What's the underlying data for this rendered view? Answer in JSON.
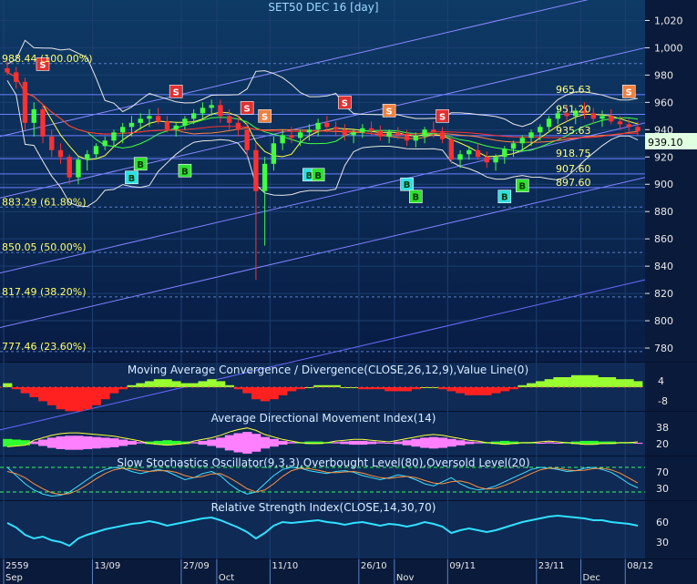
{
  "chart_data": {
    "type": "candlestick",
    "title": "SET50 DEC 16   [day]",
    "last_price": "939.10",
    "ylim": [
      770,
      1035
    ],
    "y_ticks": [
      "780",
      "800",
      "820",
      "840",
      "860",
      "880",
      "900",
      "920",
      "940",
      "960",
      "980",
      "1,000",
      "1,020"
    ],
    "y_tick_values": [
      780,
      800,
      820,
      840,
      860,
      880,
      900,
      920,
      940,
      960,
      980,
      1000,
      1020
    ],
    "x_labels": [
      "2559",
      "Sep",
      "13/09",
      "27/09",
      "Oct",
      "11/10",
      "26/10",
      "Nov",
      "09/11",
      "23/11",
      "Dec",
      "08/12"
    ],
    "x_label_index": [
      0,
      0,
      10,
      20,
      24,
      30,
      40,
      44,
      50,
      60,
      65,
      70
    ],
    "x_label_row": [
      0,
      1,
      0,
      0,
      1,
      0,
      0,
      1,
      0,
      0,
      1,
      0
    ],
    "fibonacci": [
      {
        "label": "988.44 (100.00%)",
        "value": 988.44
      },
      {
        "label": "883.29 (61.80%)",
        "value": 883.29
      },
      {
        "label": "850.05 (50.00%)",
        "value": 850.05
      },
      {
        "label": "817.49 (38.20%)",
        "value": 817.49
      },
      {
        "label": "777.46 (23.60%)",
        "value": 777.46
      }
    ],
    "levels": [
      {
        "label": "965.63",
        "value": 965.63
      },
      {
        "label": "951.20",
        "value": 951.2
      },
      {
        "label": "935.63",
        "value": 935.63
      },
      {
        "label": "918.75",
        "value": 918.75
      },
      {
        "label": "907.60",
        "value": 907.6
      },
      {
        "label": "897.60",
        "value": 897.6
      }
    ],
    "candles": [
      [
        985,
        990,
        980,
        982
      ],
      [
        982,
        986,
        970,
        975
      ],
      [
        975,
        978,
        940,
        945
      ],
      [
        945,
        960,
        935,
        955
      ],
      [
        955,
        958,
        930,
        935
      ],
      [
        935,
        940,
        920,
        925
      ],
      [
        925,
        930,
        915,
        920
      ],
      [
        920,
        922,
        900,
        905
      ],
      [
        905,
        920,
        900,
        918
      ],
      [
        918,
        925,
        910,
        922
      ],
      [
        922,
        930,
        918,
        928
      ],
      [
        928,
        935,
        925,
        932
      ],
      [
        932,
        940,
        928,
        938
      ],
      [
        938,
        945,
        930,
        942
      ],
      [
        942,
        950,
        935,
        945
      ],
      [
        945,
        952,
        940,
        948
      ],
      [
        948,
        955,
        942,
        950
      ],
      [
        950,
        956,
        944,
        946
      ],
      [
        946,
        950,
        938,
        940
      ],
      [
        940,
        945,
        935,
        943
      ],
      [
        943,
        950,
        940,
        948
      ],
      [
        948,
        955,
        944,
        952
      ],
      [
        952,
        960,
        948,
        956
      ],
      [
        956,
        962,
        950,
        958
      ],
      [
        958,
        962,
        945,
        950
      ],
      [
        950,
        955,
        940,
        945
      ],
      [
        945,
        950,
        935,
        940
      ],
      [
        940,
        945,
        920,
        925
      ],
      [
        925,
        930,
        830,
        895
      ],
      [
        895,
        920,
        855,
        915
      ],
      [
        915,
        935,
        910,
        930
      ],
      [
        930,
        940,
        925,
        936
      ],
      [
        936,
        942,
        930,
        934
      ],
      [
        934,
        940,
        928,
        938
      ],
      [
        938,
        944,
        932,
        940
      ],
      [
        940,
        948,
        935,
        945
      ],
      [
        945,
        950,
        938,
        942
      ],
      [
        942,
        946,
        935,
        940
      ],
      [
        940,
        944,
        932,
        936
      ],
      [
        936,
        940,
        930,
        938
      ],
      [
        938,
        944,
        934,
        941
      ],
      [
        941,
        946,
        936,
        939
      ],
      [
        939,
        943,
        932,
        935
      ],
      [
        935,
        940,
        930,
        938
      ],
      [
        938,
        942,
        933,
        936
      ],
      [
        936,
        940,
        928,
        932
      ],
      [
        932,
        938,
        927,
        935
      ],
      [
        935,
        942,
        930,
        940
      ],
      [
        940,
        946,
        934,
        938
      ],
      [
        938,
        942,
        930,
        933
      ],
      [
        933,
        936,
        915,
        918
      ],
      [
        918,
        925,
        912,
        922
      ],
      [
        922,
        928,
        918,
        925
      ],
      [
        925,
        930,
        918,
        920
      ],
      [
        920,
        924,
        912,
        916
      ],
      [
        916,
        922,
        910,
        920
      ],
      [
        920,
        928,
        915,
        926
      ],
      [
        926,
        932,
        920,
        930
      ],
      [
        930,
        936,
        925,
        934
      ],
      [
        934,
        940,
        928,
        938
      ],
      [
        938,
        944,
        932,
        942
      ],
      [
        942,
        950,
        938,
        948
      ],
      [
        948,
        956,
        944,
        952
      ],
      [
        952,
        958,
        946,
        950
      ],
      [
        950,
        956,
        944,
        954
      ],
      [
        954,
        960,
        948,
        952
      ],
      [
        952,
        956,
        944,
        948
      ],
      [
        948,
        954,
        942,
        950
      ],
      [
        950,
        955,
        944,
        946
      ],
      [
        946,
        950,
        940,
        944
      ],
      [
        944,
        948,
        938,
        942
      ],
      [
        942,
        946,
        936,
        939
      ]
    ],
    "signals": [
      {
        "i": 4,
        "price": 988,
        "text": "S",
        "color": "#e03030",
        "above": true
      },
      {
        "i": 19,
        "price": 968,
        "text": "S",
        "color": "#e03030",
        "above": true
      },
      {
        "i": 27,
        "price": 956,
        "text": "S",
        "color": "#e03030",
        "above": true
      },
      {
        "i": 29,
        "price": 950,
        "text": "S",
        "color": "#f08040",
        "above": true
      },
      {
        "i": 38,
        "price": 960,
        "text": "S",
        "color": "#e03030",
        "above": true
      },
      {
        "i": 43,
        "price": 954,
        "text": "S",
        "color": "#f08040",
        "above": true
      },
      {
        "i": 49,
        "price": 950,
        "text": "S",
        "color": "#e03030",
        "above": true
      },
      {
        "i": 70,
        "price": 968,
        "text": "S",
        "color": "#f08040",
        "above": true
      },
      {
        "i": 14,
        "price": 905,
        "text": "B",
        "color": "#30e0e0",
        "above": false
      },
      {
        "i": 15,
        "price": 915,
        "text": "B",
        "color": "#30e030",
        "above": false
      },
      {
        "i": 20,
        "price": 910,
        "text": "B",
        "color": "#30e030",
        "above": false
      },
      {
        "i": 34,
        "price": 907,
        "text": "B",
        "color": "#30e0e0",
        "above": false
      },
      {
        "i": 35,
        "price": 907,
        "text": "B",
        "color": "#30e030",
        "above": false
      },
      {
        "i": 45,
        "price": 900,
        "text": "B",
        "color": "#30e0e0",
        "above": false
      },
      {
        "i": 46,
        "price": 891,
        "text": "B",
        "color": "#30e030",
        "above": false
      },
      {
        "i": 56,
        "price": 891,
        "text": "B",
        "color": "#30e0e0",
        "above": false
      },
      {
        "i": 58,
        "price": 899,
        "text": "B",
        "color": "#30e030",
        "above": false
      }
    ]
  },
  "panels": {
    "macd": {
      "title": "Moving Average Convergence / Divergence(CLOSE,26,12,9),Value Line(0)",
      "y_ticks": [
        "4",
        "-8"
      ],
      "values": [
        2,
        -1,
        -3,
        -5,
        -7,
        -9,
        -11,
        -12,
        -12,
        -11,
        -9,
        -6,
        -3,
        -1,
        1,
        2,
        3,
        4,
        4,
        3,
        2,
        2,
        3,
        4,
        3,
        1,
        -1,
        -3,
        -6,
        -7,
        -6,
        -4,
        -2,
        -1,
        0,
        1,
        1,
        1,
        0,
        0,
        -1,
        -1,
        -1,
        -2,
        -2,
        -2,
        -1,
        0,
        0,
        -1,
        -2,
        -3,
        -4,
        -4,
        -4,
        -3,
        -2,
        -1,
        1,
        2,
        3,
        4,
        5,
        5,
        6,
        6,
        6,
        5,
        5,
        4,
        4,
        3
      ]
    },
    "adx": {
      "title": "Average Directional Movement Index(14)",
      "y_ticks": [
        "38",
        "20"
      ],
      "values": [
        -6,
        -5,
        -4,
        2,
        5,
        8,
        10,
        11,
        11,
        10,
        9,
        8,
        7,
        5,
        3,
        1,
        -2,
        -3,
        -4,
        -3,
        -2,
        1,
        3,
        5,
        8,
        12,
        15,
        17,
        14,
        9,
        6,
        3,
        1,
        -1,
        -2,
        -2,
        -1,
        1,
        2,
        3,
        3,
        2,
        1,
        0,
        2,
        4,
        6,
        8,
        9,
        8,
        6,
        4,
        2,
        1,
        -1,
        -2,
        -3,
        -2,
        -1,
        -1,
        0,
        1,
        0,
        -1,
        -2,
        -3,
        -3,
        -2,
        -2,
        -1,
        -1,
        0
      ]
    },
    "stochastic": {
      "title": "Slow Stochastics Oscillator(9,3,3),Overbought Level(80),Oversold Level(20)",
      "y_ticks": [
        "70",
        "30"
      ],
      "k": [
        80,
        60,
        40,
        25,
        15,
        10,
        12,
        20,
        35,
        50,
        65,
        75,
        80,
        78,
        70,
        65,
        70,
        75,
        70,
        60,
        50,
        55,
        65,
        70,
        60,
        40,
        25,
        15,
        20,
        40,
        60,
        75,
        80,
        78,
        72,
        68,
        65,
        70,
        72,
        68,
        60,
        55,
        50,
        55,
        62,
        58,
        50,
        40,
        35,
        45,
        55,
        40,
        30,
        25,
        28,
        35,
        45,
        55,
        65,
        75,
        80,
        78,
        75,
        70,
        72,
        78,
        80,
        75,
        68,
        55,
        40,
        30
      ],
      "d": [
        70,
        65,
        55,
        40,
        28,
        18,
        14,
        16,
        25,
        38,
        52,
        65,
        74,
        78,
        76,
        72,
        70,
        72,
        72,
        68,
        60,
        55,
        58,
        64,
        65,
        55,
        42,
        28,
        20,
        25,
        40,
        58,
        72,
        78,
        77,
        73,
        68,
        67,
        69,
        70,
        66,
        60,
        55,
        53,
        56,
        58,
        55,
        48,
        42,
        40,
        45,
        47,
        42,
        32,
        27,
        29,
        36,
        45,
        55,
        65,
        74,
        78,
        78,
        74,
        72,
        73,
        77,
        78,
        74,
        66,
        54,
        42
      ]
    },
    "rsi": {
      "title": "Relative Strength Index(CLOSE,14,30,70)",
      "y_ticks": [
        "60",
        "30"
      ],
      "values": [
        55,
        50,
        42,
        38,
        40,
        36,
        34,
        30,
        38,
        42,
        45,
        48,
        50,
        52,
        54,
        55,
        57,
        55,
        52,
        54,
        56,
        58,
        60,
        61,
        58,
        54,
        50,
        45,
        38,
        44,
        52,
        56,
        55,
        56,
        57,
        58,
        56,
        55,
        53,
        55,
        56,
        54,
        52,
        54,
        53,
        51,
        53,
        56,
        54,
        51,
        44,
        47,
        49,
        47,
        45,
        47,
        50,
        53,
        56,
        58,
        60,
        62,
        63,
        62,
        61,
        60,
        58,
        58,
        56,
        55,
        54,
        52
      ]
    }
  }
}
